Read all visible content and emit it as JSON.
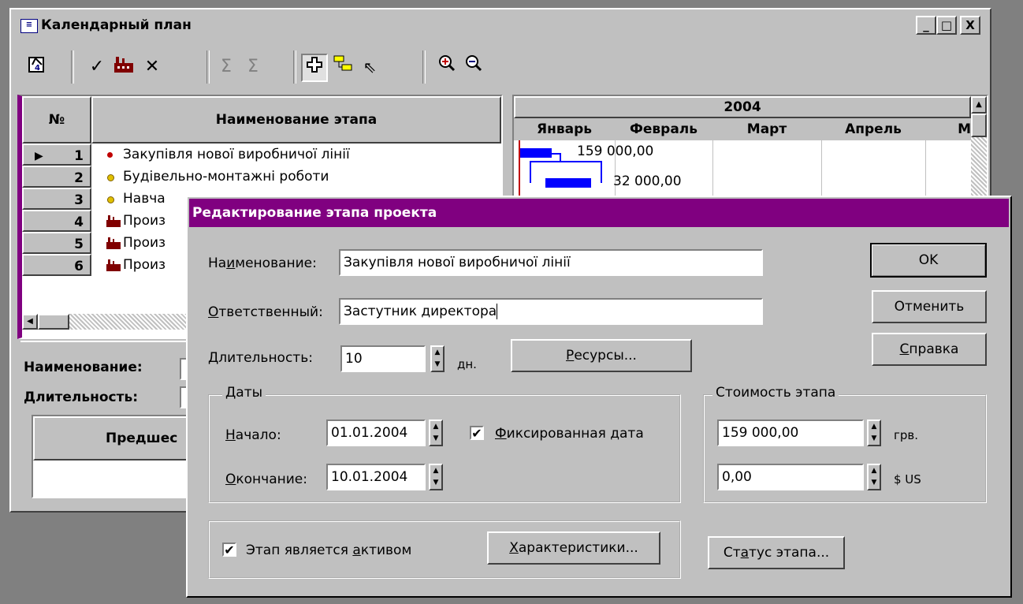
{
  "main_window": {
    "title": "Календарный план",
    "controls": [
      "_",
      "□",
      "X"
    ]
  },
  "toolbar": {
    "icons": [
      "calendar-edit-icon",
      "check-icon",
      "factory-icon",
      "delete-icon",
      "sum-left-icon",
      "sum-right-icon",
      "add-icon",
      "link-icon",
      "pointer-icon",
      "zoom-in-icon",
      "zoom-out-icon"
    ]
  },
  "grid": {
    "col_num": "№",
    "col_name": "Наименование этапа",
    "rows": [
      {
        "num": "1",
        "name": "Закупівля нової виробничої лінії",
        "marker": "red-dot"
      },
      {
        "num": "2",
        "name": "Будівельно-монтажні роботи",
        "marker": "yellow-dot"
      },
      {
        "num": "3",
        "name": "Навча",
        "marker": "yellow-dot"
      },
      {
        "num": "4",
        "name": "Произ",
        "marker": "factory"
      },
      {
        "num": "5",
        "name": "Произ",
        "marker": "factory"
      },
      {
        "num": "6",
        "name": "Произ",
        "marker": "factory"
      }
    ]
  },
  "gantt": {
    "year": "2004",
    "months": [
      "Январь",
      "Февраль",
      "Март",
      "Апрель",
      "М"
    ],
    "bar_labels": [
      "159 000,00",
      "32 000,00"
    ]
  },
  "details": {
    "name_label": "Наименование:",
    "duration_label": "Длительность:",
    "predecessors_header": "Предшес"
  },
  "dialog": {
    "title": "Редактирование этапа проекта",
    "name_label": "Наименование:",
    "name_value": "Закупівля нової виробничої лінії",
    "responsible_label": "Ответственный:",
    "responsible_value": "Застутник директора",
    "duration_label": "Длительность:",
    "duration_value": "10",
    "duration_unit": "дн.",
    "resources_button": "Ресурсы...",
    "ok_button": "OK",
    "cancel_button": "Отменить",
    "help_button": "Справка",
    "dates_group": "Даты",
    "start_label": "Начало:",
    "start_value": "01.01.2004",
    "end_label": "Окончание:",
    "end_value": "10.01.2004",
    "fixed_date_label": "Фиксированная дата",
    "fixed_date_checked": true,
    "cost_group": "Стоимость этапа",
    "cost_uah_value": "159 000,00",
    "cost_uah_unit": "грв.",
    "cost_usd_value": "0,00",
    "cost_usd_unit": "$ US",
    "asset_label": "Этап является активом",
    "asset_checked": true,
    "characteristics_button": "Характеристики...",
    "status_button": "Статус этапа..."
  }
}
